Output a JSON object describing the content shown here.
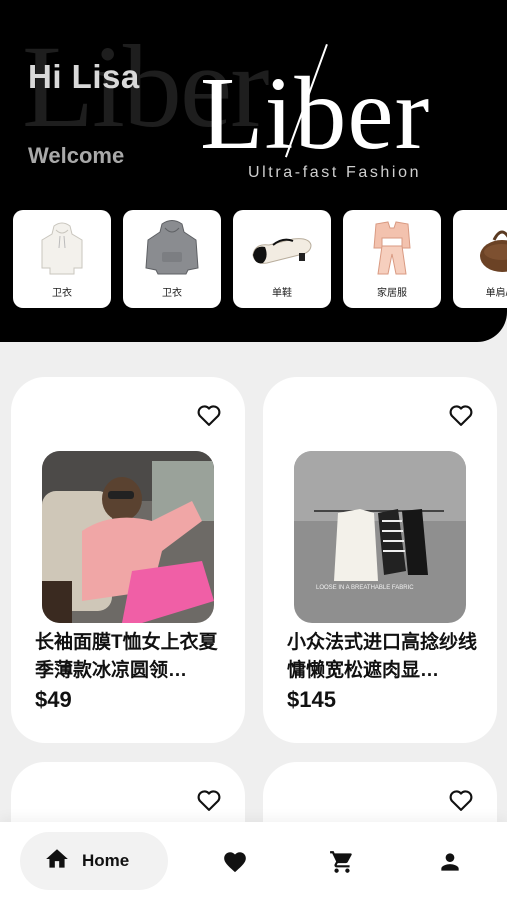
{
  "header": {
    "greeting": "Hi Lisa",
    "welcome": "Welcome",
    "brand": "Liber",
    "brand_bg": "Liber",
    "tagline": "Ultra-fast Fashion"
  },
  "categories": [
    {
      "label": "卫衣",
      "icon": "white-hoodie"
    },
    {
      "label": "卫衣",
      "icon": "grey-hoodie"
    },
    {
      "label": "单鞋",
      "icon": "mary-jane-shoe"
    },
    {
      "label": "家居服",
      "icon": "pajama-set"
    },
    {
      "label": "单肩/手",
      "icon": "handbag"
    }
  ],
  "products": [
    {
      "title": "长袖面膜T恤女上衣夏季薄款冰凉圆领…",
      "price": "$49"
    },
    {
      "title": "小众法式进口高捻纱线慵懒宽松遮肉显…",
      "price": "$145"
    }
  ],
  "photo_caption": "LOOSE IN A BREATHABLE FABRIC",
  "nav": {
    "home_label": "Home"
  },
  "colors": {
    "header_bg": "#000000",
    "page_bg": "#efefef",
    "card_bg": "#ffffff"
  }
}
